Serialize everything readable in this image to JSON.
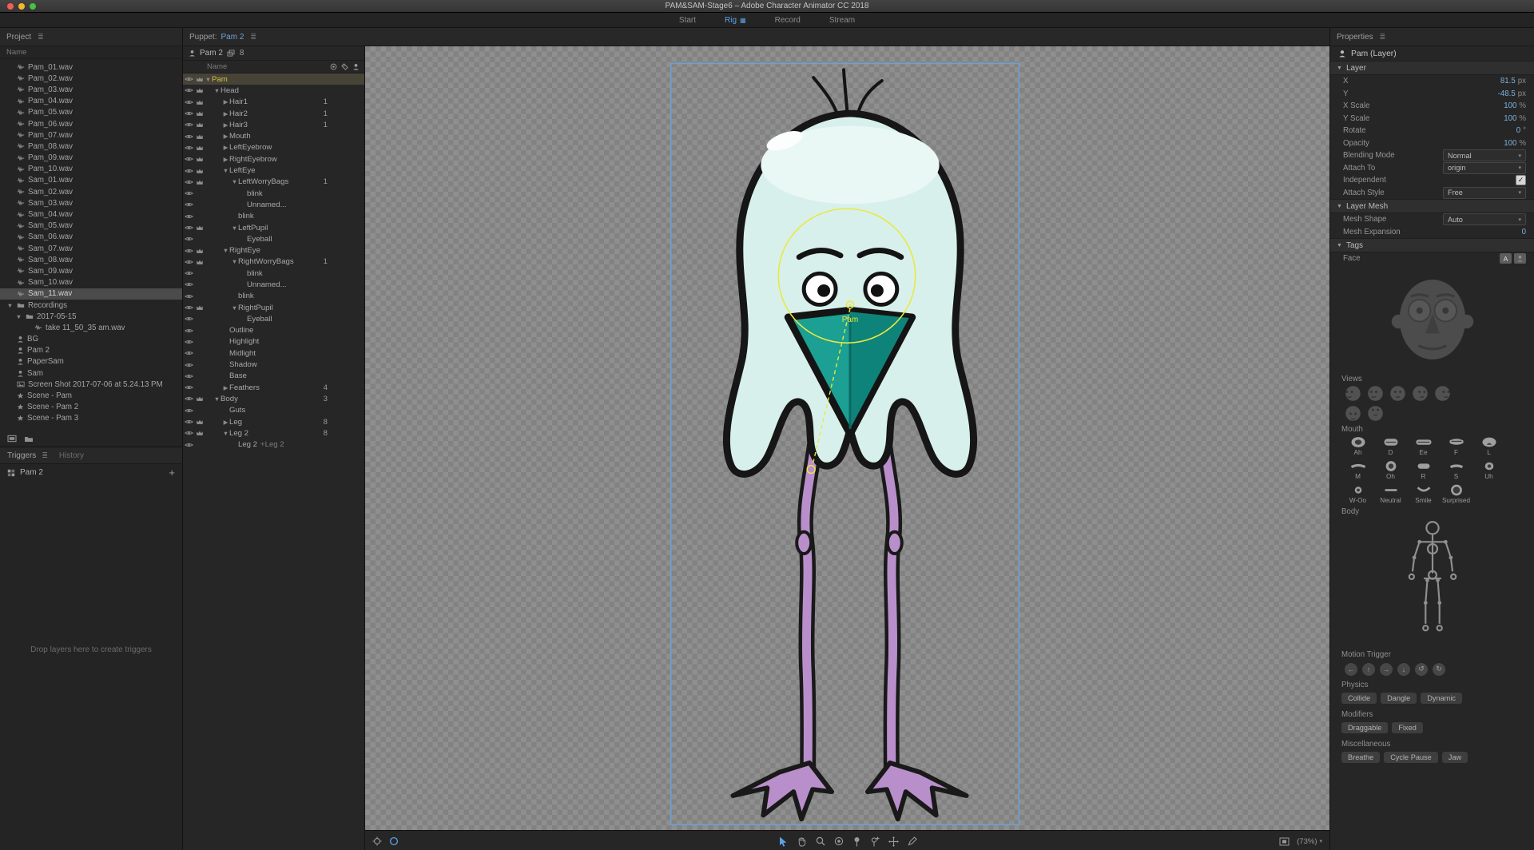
{
  "titlebar": {
    "title": "PAM&SAM-Stage6 – Adobe Character Animator CC 2018"
  },
  "mode_tabs": [
    {
      "label": "Start",
      "active": false
    },
    {
      "label": "Rig",
      "active": true
    },
    {
      "label": "Record",
      "active": false
    },
    {
      "label": "Stream",
      "active": false
    }
  ],
  "project": {
    "title": "Project",
    "name_header": "Name",
    "items": [
      {
        "label": "Pam_01.wav",
        "type": "audio"
      },
      {
        "label": "Pam_02.wav",
        "type": "audio"
      },
      {
        "label": "Pam_03.wav",
        "type": "audio"
      },
      {
        "label": "Pam_04.wav",
        "type": "audio"
      },
      {
        "label": "Pam_05.wav",
        "type": "audio"
      },
      {
        "label": "Pam_06.wav",
        "type": "audio"
      },
      {
        "label": "Pam_07.wav",
        "type": "audio"
      },
      {
        "label": "Pam_08.wav",
        "type": "audio"
      },
      {
        "label": "Pam_09.wav",
        "type": "audio"
      },
      {
        "label": "Pam_10.wav",
        "type": "audio"
      },
      {
        "label": "Sam_01.wav",
        "type": "audio"
      },
      {
        "label": "Sam_02.wav",
        "type": "audio"
      },
      {
        "label": "Sam_03.wav",
        "type": "audio"
      },
      {
        "label": "Sam_04.wav",
        "type": "audio"
      },
      {
        "label": "Sam_05.wav",
        "type": "audio"
      },
      {
        "label": "Sam_06.wav",
        "type": "audio"
      },
      {
        "label": "Sam_07.wav",
        "type": "audio"
      },
      {
        "label": "Sam_08.wav",
        "type": "audio"
      },
      {
        "label": "Sam_09.wav",
        "type": "audio"
      },
      {
        "label": "Sam_10.wav",
        "type": "audio"
      },
      {
        "label": "Sam_11.wav",
        "type": "audio",
        "selected": true
      },
      {
        "label": "Recordings",
        "type": "folder",
        "twirl": "open"
      },
      {
        "label": "2017-05-15",
        "type": "folder",
        "twirl": "open",
        "indent": 1
      },
      {
        "label": "take 11_50_35 am.wav",
        "type": "audio",
        "indent": 2
      },
      {
        "label": "BG",
        "type": "puppet"
      },
      {
        "label": "Pam 2",
        "type": "puppet"
      },
      {
        "label": "PaperSam",
        "type": "puppet"
      },
      {
        "label": "Sam",
        "type": "puppet"
      },
      {
        "label": "Screen Shot 2017-07-06 at 5.24.13 PM",
        "type": "image"
      },
      {
        "label": "Scene - Pam",
        "type": "scene"
      },
      {
        "label": "Scene - Pam 2",
        "type": "scene"
      },
      {
        "label": "Scene - Pam 3",
        "type": "scene"
      }
    ]
  },
  "triggers": {
    "tab_triggers": "Triggers",
    "tab_history": "History",
    "items": [
      {
        "label": "Pam 2"
      }
    ],
    "add_label": "+",
    "empty_text": "Drop layers here to create triggers"
  },
  "puppet": {
    "panel_title": "Puppet:",
    "panel_puppet": "Pam 2",
    "root_label": "Pam 2",
    "root_count": "8",
    "name_header": "Name",
    "rows": [
      {
        "label": "Pam",
        "indent": 0,
        "twirl": "open",
        "crown": true,
        "selected": true
      },
      {
        "label": "Head",
        "indent": 1,
        "twirl": "open",
        "crown": true
      },
      {
        "label": "Hair1",
        "indent": 2,
        "twirl": "closed",
        "crown": true,
        "badge": "1"
      },
      {
        "label": "Hair2",
        "indent": 2,
        "twirl": "closed",
        "crown": true,
        "badge": "1"
      },
      {
        "label": "Hair3",
        "indent": 2,
        "twirl": "closed",
        "crown": true,
        "badge": "1"
      },
      {
        "label": "Mouth",
        "indent": 2,
        "twirl": "closed",
        "crown": true
      },
      {
        "label": "LeftEyebrow",
        "indent": 2,
        "twirl": "closed",
        "crown": true
      },
      {
        "label": "RightEyebrow",
        "indent": 2,
        "twirl": "closed",
        "crown": true
      },
      {
        "label": "LeftEye",
        "indent": 2,
        "twirl": "open",
        "crown": true
      },
      {
        "label": "LeftWorryBags",
        "indent": 3,
        "twirl": "open",
        "crown": true,
        "badge": "1"
      },
      {
        "label": "blink",
        "indent": 4
      },
      {
        "label": "Unnamed...",
        "indent": 4
      },
      {
        "label": "blink",
        "indent": 3
      },
      {
        "label": "LeftPupil",
        "indent": 3,
        "twirl": "open",
        "crown": true
      },
      {
        "label": "Eyeball",
        "indent": 4
      },
      {
        "label": "RightEye",
        "indent": 2,
        "twirl": "open",
        "crown": true
      },
      {
        "label": "RightWorryBags",
        "indent": 3,
        "twirl": "open",
        "crown": true,
        "badge": "1"
      },
      {
        "label": "blink",
        "indent": 4
      },
      {
        "label": "Unnamed...",
        "indent": 4
      },
      {
        "label": "blink",
        "indent": 3
      },
      {
        "label": "RightPupil",
        "indent": 3,
        "twirl": "open",
        "crown": true
      },
      {
        "label": "Eyeball",
        "indent": 4
      },
      {
        "label": "Outline",
        "indent": 2
      },
      {
        "label": "Highlight",
        "indent": 2
      },
      {
        "label": "Midlight",
        "indent": 2
      },
      {
        "label": "Shadow",
        "indent": 2
      },
      {
        "label": "Base",
        "indent": 2
      },
      {
        "label": "Feathers",
        "indent": 2,
        "twirl": "closed",
        "badge": "4"
      },
      {
        "label": "Body",
        "indent": 1,
        "twirl": "open",
        "crown": true,
        "badge": "3"
      },
      {
        "label": "Guts",
        "indent": 2
      },
      {
        "label": "Leg",
        "indent": 2,
        "twirl": "closed",
        "crown": true,
        "badge": "8"
      },
      {
        "label": "Leg 2",
        "indent": 2,
        "twirl": "open",
        "crown": true,
        "badge": "8"
      },
      {
        "label": "Leg 2",
        "indent": 3,
        "suffix": "+Leg 2"
      }
    ]
  },
  "canvas": {
    "zoom_label": "(73%)",
    "origin_label": "Pam",
    "accent_yellow": "#e9e93e",
    "selection_blue": "#6ba3d6"
  },
  "properties": {
    "title": "Properties",
    "target": "Pam (Layer)",
    "layer_section": "Layer",
    "layer_rows": [
      {
        "label": "X",
        "type": "value",
        "value": "81.5",
        "unit": "px"
      },
      {
        "label": "Y",
        "type": "value",
        "value": "-48.5",
        "unit": "px"
      },
      {
        "label": "X Scale",
        "type": "value",
        "value": "100",
        "unit": "%"
      },
      {
        "label": "Y Scale",
        "type": "value",
        "value": "100",
        "unit": "%"
      },
      {
        "label": "Rotate",
        "type": "value",
        "value": "0",
        "unit": "°"
      },
      {
        "label": "Opacity",
        "type": "value",
        "value": "100",
        "unit": "%"
      },
      {
        "label": "Blending Mode",
        "type": "dropdown",
        "value": "Normal"
      },
      {
        "label": "Attach To",
        "type": "dropdown",
        "value": "origin"
      },
      {
        "label": "Independent",
        "type": "checkbox",
        "checked": true
      },
      {
        "label": "Attach Style",
        "type": "dropdown",
        "value": "Free"
      }
    ],
    "mesh_section": "Layer Mesh",
    "mesh_rows": [
      {
        "label": "Mesh Shape",
        "type": "dropdown",
        "value": "Auto"
      },
      {
        "label": "Mesh Expansion",
        "type": "value",
        "value": "0",
        "unit": ""
      }
    ],
    "tags_section": "Tags",
    "face_label": "Face",
    "face_buttons": [
      "A"
    ],
    "views_label": "Views",
    "views_rows": [
      5,
      2
    ],
    "mouth_label": "Mouth",
    "mouths": [
      {
        "label": "Ah",
        "shape": "ah"
      },
      {
        "label": "D",
        "shape": "d"
      },
      {
        "label": "Ee",
        "shape": "ee"
      },
      {
        "label": "F",
        "shape": "f"
      },
      {
        "label": "L",
        "shape": "l"
      },
      {
        "label": "M",
        "shape": "m"
      },
      {
        "label": "Oh",
        "shape": "oh"
      },
      {
        "label": "R",
        "shape": "r"
      },
      {
        "label": "S",
        "shape": "s"
      },
      {
        "label": "Uh",
        "shape": "uh"
      },
      {
        "label": "W-Oo",
        "shape": "woo"
      },
      {
        "label": "Neutral",
        "shape": "neutral"
      },
      {
        "label": "Smile",
        "shape": "smile"
      },
      {
        "label": "Surprised",
        "shape": "surprised"
      }
    ],
    "body_label": "Body",
    "motion_trigger_label": "Motion Trigger",
    "motion_icons": [
      "left",
      "up",
      "right",
      "down",
      "ccw",
      "cw"
    ],
    "physics_label": "Physics",
    "physics_buttons": [
      "Collide",
      "Dangle",
      "Dynamic"
    ],
    "modifiers_label": "Modifiers",
    "modifier_buttons": [
      "Draggable",
      "Fixed"
    ],
    "misc_label": "Miscellaneous",
    "misc_buttons": [
      "Breathe",
      "Cycle Pause",
      "Jaw"
    ]
  }
}
